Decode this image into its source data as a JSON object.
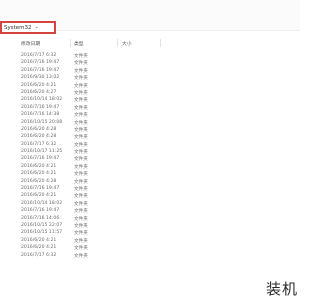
{
  "breadcrumb": {
    "path": "System32"
  },
  "columns": {
    "date": "修改日期",
    "type": "类型",
    "size": "大小"
  },
  "rows": [
    {
      "date": "2016/7/17 6:32",
      "type": "文件夹"
    },
    {
      "date": "2016/7/16 19:47",
      "type": "文件夹"
    },
    {
      "date": "2016/7/16 19:47",
      "type": "文件夹"
    },
    {
      "date": "2016/9/30 13:02",
      "type": "文件夹"
    },
    {
      "date": "2016/6/20 4:21",
      "type": "文件夹"
    },
    {
      "date": "2016/6/20 4:27",
      "type": "文件夹"
    },
    {
      "date": "2016/10/14 18:02",
      "type": "文件夹"
    },
    {
      "date": "2016/7/16 19:47",
      "type": "文件夹"
    },
    {
      "date": "2016/7/16 14:38",
      "type": "文件夹"
    },
    {
      "date": "2016/10/15 20:08",
      "type": "文件夹"
    },
    {
      "date": "2016/6/20 4:28",
      "type": "文件夹"
    },
    {
      "date": "2016/6/20 4:28",
      "type": "文件夹"
    },
    {
      "date": "2016/7/17 6:32",
      "type": "文件夹"
    },
    {
      "date": "2016/10/17 11:25",
      "type": "文件夹"
    },
    {
      "date": "2016/7/16 19:47",
      "type": "文件夹"
    },
    {
      "date": "2016/6/20 4:21",
      "type": "文件夹"
    },
    {
      "date": "2016/6/20 4:21",
      "type": "文件夹"
    },
    {
      "date": "2016/6/20 4:28",
      "type": "文件夹"
    },
    {
      "date": "2016/7/16 19:47",
      "type": "文件夹"
    },
    {
      "date": "2016/6/20 4:21",
      "type": "文件夹"
    },
    {
      "date": "2016/10/14 18:02",
      "type": "文件夹"
    },
    {
      "date": "2016/7/16 19:47",
      "type": "文件夹"
    },
    {
      "date": "2016/7/16 14:06",
      "type": "文件夹"
    },
    {
      "date": "2016/10/15 22:07",
      "type": "文件夹"
    },
    {
      "date": "2016/10/15 11:57",
      "type": "文件夹"
    },
    {
      "date": "2016/6/20 4:21",
      "type": "文件夹"
    },
    {
      "date": "2016/6/20 4:21",
      "type": "文件夹"
    },
    {
      "date": "2016/7/17 6:32",
      "type": "文件夹"
    }
  ],
  "watermark": {
    "text": "装机"
  },
  "colors": {
    "highlight_border": "#d6453b"
  }
}
